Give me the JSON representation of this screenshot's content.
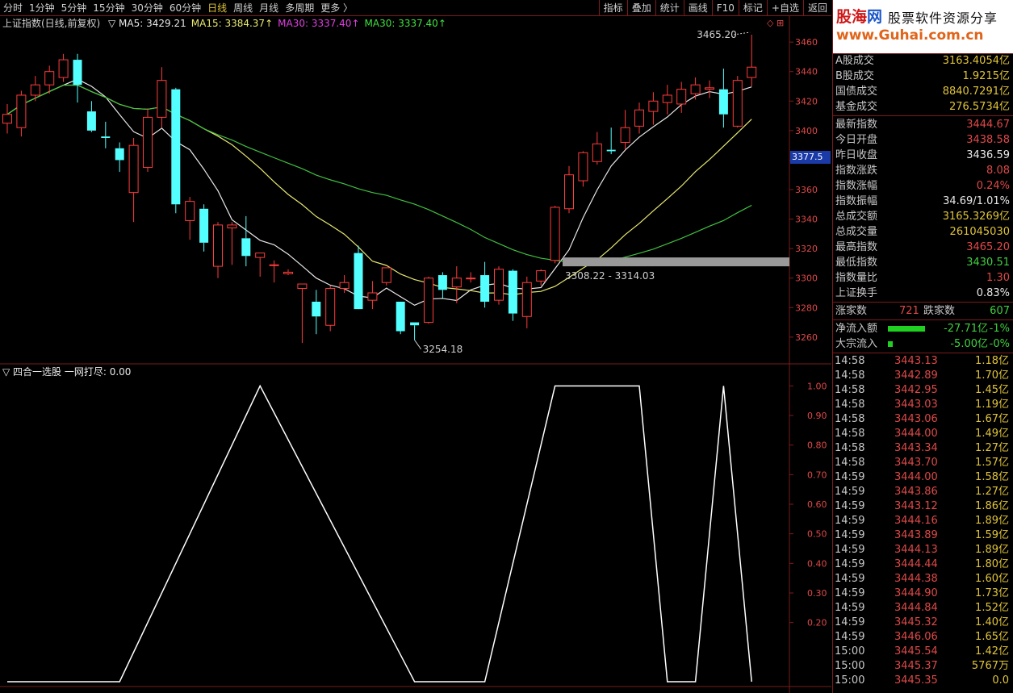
{
  "toolbar": {
    "timeframes": [
      "分时",
      "1分钟",
      "5分钟",
      "15分钟",
      "30分钟",
      "60分钟",
      "日线",
      "周线",
      "月线",
      "多周期",
      "更多 〉"
    ],
    "active_timeframe": "日线",
    "right_buttons": [
      "指标",
      "叠加",
      "统计",
      "画线",
      "F10",
      "标记",
      "+自选",
      "返回"
    ]
  },
  "main_chart": {
    "title": "上证指数(日线,前复权)",
    "ma_labels": [
      {
        "text": "▽ MA5: 3429.21",
        "color": "#e8e8e8"
      },
      {
        "text": "MA15: 3384.37↑",
        "color": "#e8e870"
      },
      {
        "text": "MA30: 3337.40↑",
        "color": "#e040e0"
      },
      {
        "text": "MA30: 3337.40↑",
        "color": "#40e040"
      }
    ],
    "y_ticks": [
      "3460",
      "3440",
      "3420",
      "3400",
      "3380",
      "3360",
      "3340",
      "3320",
      "3300",
      "3280",
      "3260"
    ],
    "current_price_tag": "3377.5",
    "annotations": {
      "high": "3465.20",
      "low": "3254.18",
      "range": "3308.22 - 3314.03"
    },
    "corner_icons": [
      "◇",
      "⊞"
    ]
  },
  "chart_data": {
    "type": "candlestick",
    "ylim": [
      3250,
      3470
    ],
    "candles": [
      {
        "o": 3405,
        "h": 3418,
        "l": 3398,
        "c": 3411
      },
      {
        "o": 3402,
        "h": 3427,
        "l": 3396,
        "c": 3424
      },
      {
        "o": 3424,
        "h": 3437,
        "l": 3420,
        "c": 3431
      },
      {
        "o": 3431,
        "h": 3444,
        "l": 3425,
        "c": 3440
      },
      {
        "o": 3436,
        "h": 3452,
        "l": 3433,
        "c": 3448
      },
      {
        "o": 3448,
        "h": 3452,
        "l": 3419,
        "c": 3431
      },
      {
        "o": 3413,
        "h": 3420,
        "l": 3399,
        "c": 3400
      },
      {
        "o": 3396,
        "h": 3406,
        "l": 3388,
        "c": 3395
      },
      {
        "o": 3388,
        "h": 3392,
        "l": 3372,
        "c": 3380
      },
      {
        "o": 3358,
        "h": 3395,
        "l": 3338,
        "c": 3390
      },
      {
        "o": 3375,
        "h": 3415,
        "l": 3372,
        "c": 3409
      },
      {
        "o": 3409,
        "h": 3443,
        "l": 3402,
        "c": 3434
      },
      {
        "o": 3428,
        "h": 3429,
        "l": 3344,
        "c": 3350
      },
      {
        "o": 3339,
        "h": 3355,
        "l": 3326,
        "c": 3352
      },
      {
        "o": 3347,
        "h": 3350,
        "l": 3318,
        "c": 3324
      },
      {
        "o": 3308,
        "h": 3338,
        "l": 3300,
        "c": 3336
      },
      {
        "o": 3334,
        "h": 3338,
        "l": 3309,
        "c": 3336
      },
      {
        "o": 3327,
        "h": 3342,
        "l": 3308,
        "c": 3315
      },
      {
        "o": 3314,
        "h": 3316,
        "l": 3301,
        "c": 3317
      },
      {
        "o": 3309,
        "h": 3312,
        "l": 3297,
        "c": 3309
      },
      {
        "o": 3303,
        "h": 3306,
        "l": 3302,
        "c": 3304
      },
      {
        "o": 3293,
        "h": 3296,
        "l": 3256,
        "c": 3296
      },
      {
        "o": 3284,
        "h": 3292,
        "l": 3262,
        "c": 3274
      },
      {
        "o": 3268,
        "h": 3295,
        "l": 3264,
        "c": 3293
      },
      {
        "o": 3293,
        "h": 3302,
        "l": 3290,
        "c": 3297
      },
      {
        "o": 3317,
        "h": 3322,
        "l": 3291,
        "c": 3279
      },
      {
        "o": 3285,
        "h": 3298,
        "l": 3279,
        "c": 3290
      },
      {
        "o": 3297,
        "h": 3307,
        "l": 3295,
        "c": 3307
      },
      {
        "o": 3284,
        "h": 3284,
        "l": 3262,
        "c": 3264
      },
      {
        "o": 3270,
        "h": 3270,
        "l": 3258,
        "c": 3268
      },
      {
        "o": 3270,
        "h": 3301,
        "l": 3269,
        "c": 3300
      },
      {
        "o": 3302,
        "h": 3304,
        "l": 3286,
        "c": 3292
      },
      {
        "o": 3294,
        "h": 3308,
        "l": 3283,
        "c": 3300
      },
      {
        "o": 3300,
        "h": 3304,
        "l": 3297,
        "c": 3300
      },
      {
        "o": 3302,
        "h": 3311,
        "l": 3280,
        "c": 3284
      },
      {
        "o": 3285,
        "h": 3308,
        "l": 3282,
        "c": 3306
      },
      {
        "o": 3305,
        "h": 3306,
        "l": 3271,
        "c": 3276
      },
      {
        "o": 3274,
        "h": 3301,
        "l": 3266,
        "c": 3297
      },
      {
        "o": 3298,
        "h": 3306,
        "l": 3295,
        "c": 3305
      },
      {
        "o": 3312,
        "h": 3349,
        "l": 3310,
        "c": 3348
      },
      {
        "o": 3347,
        "h": 3376,
        "l": 3344,
        "c": 3370
      },
      {
        "o": 3366,
        "h": 3386,
        "l": 3362,
        "c": 3385
      },
      {
        "o": 3379,
        "h": 3399,
        "l": 3377,
        "c": 3391
      },
      {
        "o": 3387,
        "h": 3402,
        "l": 3384,
        "c": 3386
      },
      {
        "o": 3392,
        "h": 3414,
        "l": 3387,
        "c": 3402
      },
      {
        "o": 3403,
        "h": 3419,
        "l": 3398,
        "c": 3414
      },
      {
        "o": 3413,
        "h": 3426,
        "l": 3404,
        "c": 3420
      },
      {
        "o": 3419,
        "h": 3431,
        "l": 3411,
        "c": 3424
      },
      {
        "o": 3418,
        "h": 3433,
        "l": 3412,
        "c": 3428
      },
      {
        "o": 3425,
        "h": 3436,
        "l": 3421,
        "c": 3431
      },
      {
        "o": 3428,
        "h": 3434,
        "l": 3422,
        "c": 3429
      },
      {
        "o": 3428,
        "h": 3442,
        "l": 3402,
        "c": 3411
      },
      {
        "o": 3403,
        "h": 3437,
        "l": 3402,
        "c": 3434
      },
      {
        "o": 3436,
        "h": 3465,
        "l": 3430,
        "c": 3443
      }
    ],
    "indicator": {
      "title": "▽ 四合一选股 一网打尽: 0.00",
      "y_ticks": [
        "1.00",
        "0.90",
        "0.80",
        "0.70",
        "0.60",
        "0.50",
        "0.40",
        "0.30",
        "0.20"
      ],
      "ylim": [
        0,
        1.05
      ],
      "x": [
        0,
        8,
        18,
        29,
        34,
        39,
        45,
        47,
        49,
        51,
        53
      ],
      "values": [
        0,
        0,
        1,
        0,
        0,
        1,
        1,
        0,
        0,
        1,
        0
      ]
    }
  },
  "panel": {
    "logo": {
      "brand_a": "股海",
      "brand_b": "网",
      "tagline": "股票软件资源分享",
      "url": "www.Guhai.com.cn"
    },
    "stats1": [
      {
        "k": "A股成交",
        "v": "3163.4054亿",
        "color": "#e0c43a"
      },
      {
        "k": "B股成交",
        "v": "1.9215亿",
        "color": "#e0c43a"
      },
      {
        "k": "国债成交",
        "v": "8840.7291亿",
        "color": "#e0c43a"
      },
      {
        "k": "基金成交",
        "v": "276.5734亿",
        "color": "#e0c43a"
      }
    ],
    "stats2": [
      {
        "k": "最新指数",
        "v": "3444.67",
        "color": "#e04848"
      },
      {
        "k": "今日开盘",
        "v": "3438.58",
        "color": "#e04848"
      },
      {
        "k": "昨日收盘",
        "v": "3436.59",
        "color": "#e8e8e8"
      },
      {
        "k": "指数涨跌",
        "v": "8.08",
        "color": "#e04848"
      },
      {
        "k": "指数涨幅",
        "v": "0.24%",
        "color": "#e04848"
      },
      {
        "k": "指数振幅",
        "v": "34.69/1.01%",
        "color": "#e8e8e8"
      },
      {
        "k": "总成交额",
        "v": "3165.3269亿",
        "color": "#e0c43a"
      },
      {
        "k": "总成交量",
        "v": "261045030",
        "color": "#e0c43a"
      },
      {
        "k": "最高指数",
        "v": "3465.20",
        "color": "#e04848"
      },
      {
        "k": "最低指数",
        "v": "3430.51",
        "color": "#40d040"
      },
      {
        "k": "指数量比",
        "v": "1.30",
        "color": "#e04848"
      },
      {
        "k": "上证换手",
        "v": "0.83%",
        "color": "#e8e8e8"
      }
    ],
    "updown": {
      "up_label": "涨家数",
      "up": "721",
      "down_label": "跌家数",
      "down": "607"
    },
    "flows": [
      {
        "k": "净流入额",
        "v": "-27.71亿",
        "pct": "-1%"
      },
      {
        "k": "大宗流入",
        "v": "-5.00亿",
        "pct": "-0%"
      }
    ],
    "ticks": [
      [
        "14:58",
        "3443.13",
        "1.18亿"
      ],
      [
        "14:58",
        "3442.89",
        "1.70亿"
      ],
      [
        "14:58",
        "3442.95",
        "1.45亿"
      ],
      [
        "14:58",
        "3443.03",
        "1.19亿"
      ],
      [
        "14:58",
        "3443.06",
        "1.67亿"
      ],
      [
        "14:58",
        "3444.00",
        "1.49亿"
      ],
      [
        "14:58",
        "3443.34",
        "1.27亿"
      ],
      [
        "14:58",
        "3443.70",
        "1.57亿"
      ],
      [
        "14:59",
        "3444.00",
        "1.58亿"
      ],
      [
        "14:59",
        "3443.86",
        "1.27亿"
      ],
      [
        "14:59",
        "3443.12",
        "1.86亿"
      ],
      [
        "14:59",
        "3444.16",
        "1.89亿"
      ],
      [
        "14:59",
        "3443.89",
        "1.59亿"
      ],
      [
        "14:59",
        "3444.13",
        "1.89亿"
      ],
      [
        "14:59",
        "3444.44",
        "1.80亿"
      ],
      [
        "14:59",
        "3444.38",
        "1.60亿"
      ],
      [
        "14:59",
        "3444.90",
        "1.73亿"
      ],
      [
        "14:59",
        "3444.84",
        "1.52亿"
      ],
      [
        "14:59",
        "3445.32",
        "1.40亿"
      ],
      [
        "14:59",
        "3446.06",
        "1.65亿"
      ],
      [
        "15:00",
        "3445.54",
        "1.42亿"
      ],
      [
        "15:00",
        "3445.37",
        "5767万"
      ],
      [
        "15:00",
        "3445.35",
        "0.0"
      ]
    ]
  }
}
